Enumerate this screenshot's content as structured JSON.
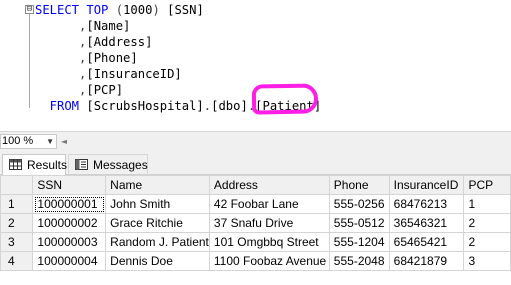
{
  "editor": {
    "fold_toggle": "⊟",
    "lines": [
      {
        "parts": [
          {
            "t": "SELECT",
            "c": "kw"
          },
          {
            "t": " ",
            "c": "id"
          },
          {
            "t": "TOP",
            "c": "kw"
          },
          {
            "t": " (",
            "c": "pl"
          },
          {
            "t": "1000",
            "c": "num"
          },
          {
            "t": ") ",
            "c": "pl"
          },
          {
            "t": "[SSN]",
            "c": "id"
          }
        ]
      },
      {
        "parts": [
          {
            "t": "      ,",
            "c": "pl"
          },
          {
            "t": "[Name]",
            "c": "id"
          }
        ]
      },
      {
        "parts": [
          {
            "t": "      ,",
            "c": "pl"
          },
          {
            "t": "[Address]",
            "c": "id"
          }
        ]
      },
      {
        "parts": [
          {
            "t": "      ,",
            "c": "pl"
          },
          {
            "t": "[Phone]",
            "c": "id"
          }
        ]
      },
      {
        "parts": [
          {
            "t": "      ,",
            "c": "pl"
          },
          {
            "t": "[InsuranceID]",
            "c": "id"
          }
        ]
      },
      {
        "parts": [
          {
            "t": "      ,",
            "c": "pl"
          },
          {
            "t": "[PCP]",
            "c": "id"
          }
        ]
      },
      {
        "parts": [
          {
            "t": "  FROM",
            "c": "kw"
          },
          {
            "t": " ",
            "c": "id"
          },
          {
            "t": "[ScrubsHospital]",
            "c": "id"
          },
          {
            "t": ".",
            "c": "pl"
          },
          {
            "t": "[dbo]",
            "c": "id"
          },
          {
            "t": ".",
            "c": "pl"
          },
          {
            "t": "[Patient]",
            "c": "id"
          }
        ]
      }
    ],
    "highlight_color": "#ff1ee6"
  },
  "zoom": {
    "value": "100 %",
    "arrow": "▼",
    "scroll_left": "◄"
  },
  "tabs": [
    {
      "label": "Results",
      "icon": "grid-icon",
      "active": true
    },
    {
      "label": "Messages",
      "icon": "messages-icon",
      "active": false
    }
  ],
  "results": {
    "columns": [
      "SSN",
      "Name",
      "Address",
      "Phone",
      "InsuranceID",
      "PCP"
    ],
    "rows": [
      [
        "1",
        "100000001",
        "John Smith",
        "42 Foobar Lane",
        "555-0256",
        "68476213",
        "1"
      ],
      [
        "2",
        "100000002",
        "Grace Ritchie",
        "37 Snafu Drive",
        "555-0512",
        "36546321",
        "2"
      ],
      [
        "3",
        "100000003",
        "Random J. Patient",
        "101 Omgbbq Street",
        "555-1204",
        "65465421",
        "2"
      ],
      [
        "4",
        "100000004",
        "Dennis Doe",
        "1100 Foobaz Avenue",
        "555-2048",
        "68421879",
        "3"
      ]
    ]
  },
  "colors": {
    "keyword": "#0000ff",
    "highlight": "#ff1ee6"
  }
}
